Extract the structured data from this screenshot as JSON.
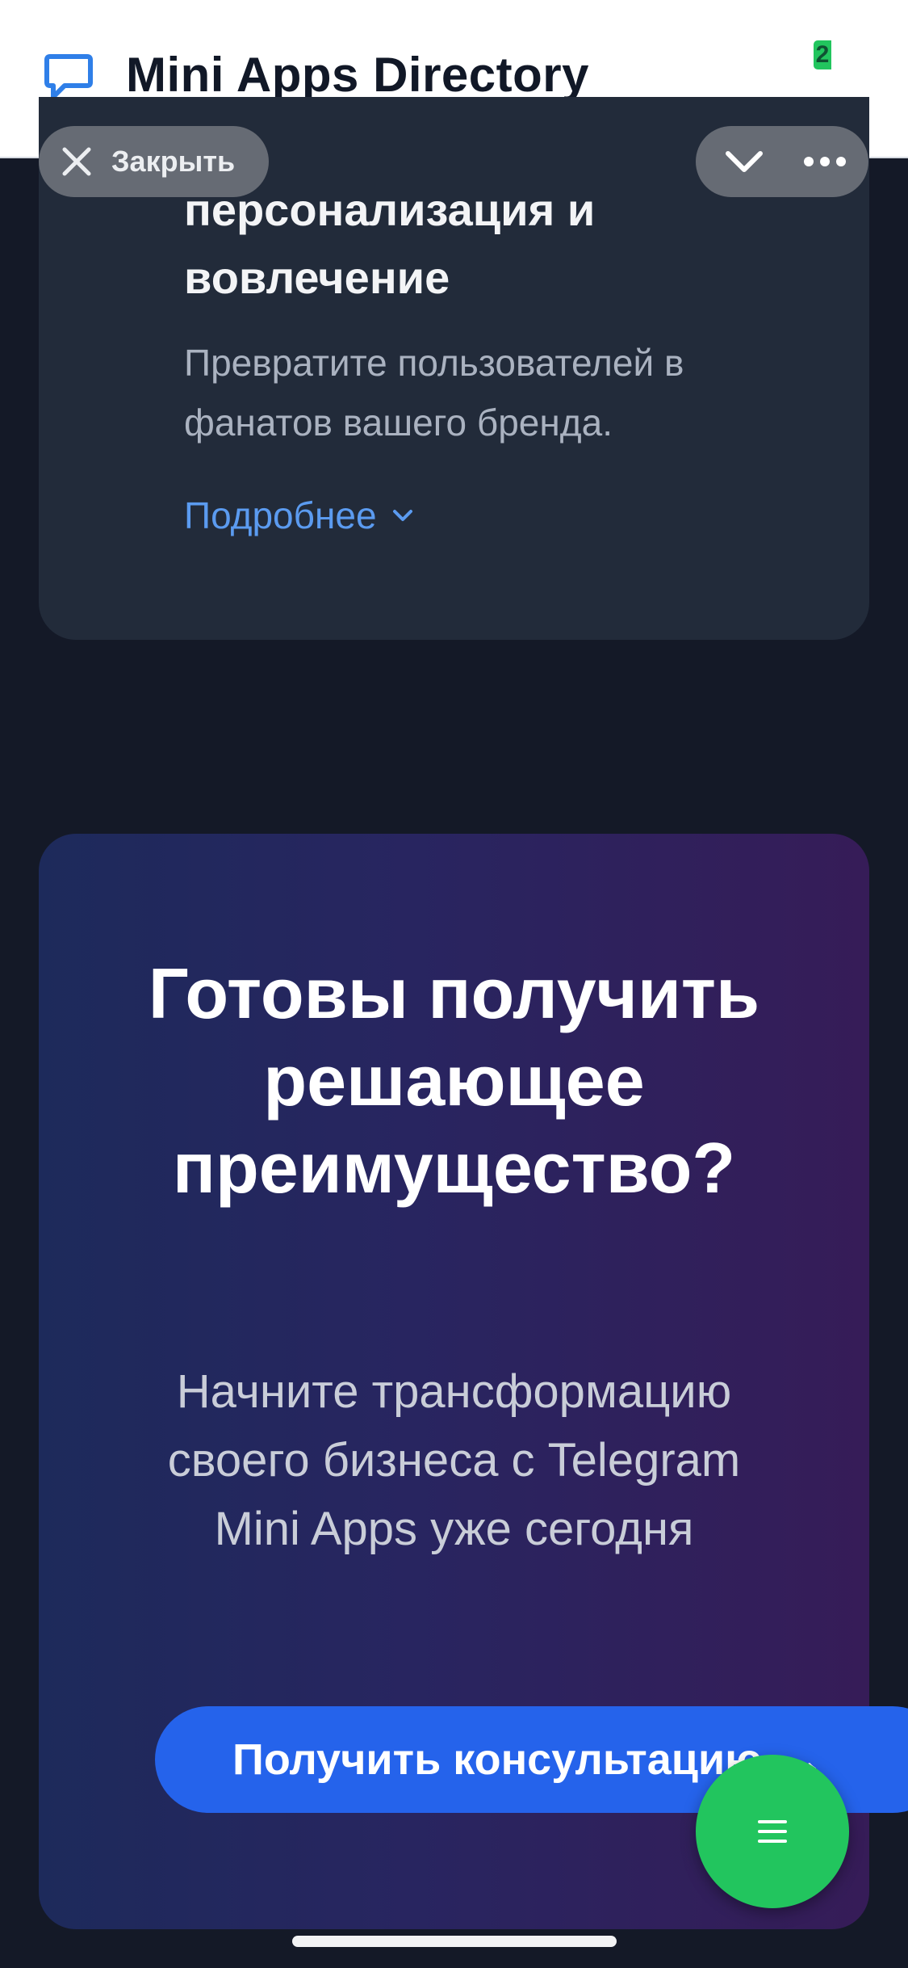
{
  "header": {
    "title": "Mini Apps Directory",
    "badge": "2",
    "icon": "chat-bubble-icon"
  },
  "overlay": {
    "close_label": "Закрыть",
    "close_icon": "close-icon",
    "collapse_icon": "chevron-down-icon",
    "more_icon": "more-dots-icon"
  },
  "feature_card": {
    "heading": "персонализация и вовлечение",
    "description": "Превратите пользователей в фанатов вашего бренда.",
    "more_label": "Подробнее"
  },
  "cta": {
    "title": "Готовы получить решающее преимущество?",
    "subtitle": "Начните трансформацию своего бизнеса с Telegram Mini Apps уже сегодня",
    "button_label": "Получить консультацию",
    "button_arrow": "→"
  },
  "fab": {
    "icon": "menu-icon"
  },
  "colors": {
    "background": "#141927",
    "card": "#222b3a",
    "accent_blue": "#2563eb",
    "link": "#5b9bf0",
    "fab_green": "#22c55e"
  }
}
